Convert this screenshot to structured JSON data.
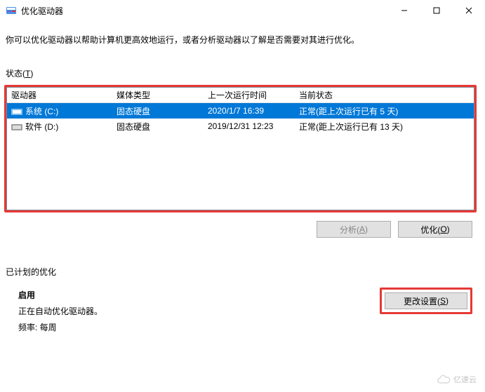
{
  "window": {
    "title": "优化驱动器"
  },
  "description": "你可以优化驱动器以帮助计算机更高效地运行，或者分析驱动器以了解是否需要对其进行优化。",
  "status_label_prefix": "状态(",
  "status_label_key": "T",
  "status_label_suffix": ")",
  "table": {
    "headers": {
      "drive": "驱动器",
      "media": "媒体类型",
      "last_run": "上一次运行时间",
      "current": "当前状态"
    },
    "rows": [
      {
        "drive": "系统 (C:)",
        "media": "固态硬盘",
        "last_run": "2020/1/7 16:39",
        "current": "正常(距上次运行已有 5 天)",
        "selected": true,
        "icon": "drive-blue"
      },
      {
        "drive": "软件 (D:)",
        "media": "固态硬盘",
        "last_run": "2019/12/31 12:23",
        "current": "正常(距上次运行已有 13 天)",
        "selected": false,
        "icon": "drive-gray"
      }
    ]
  },
  "buttons": {
    "analyze_prefix": "分析(",
    "analyze_key": "A",
    "analyze_suffix": ")",
    "optimize_prefix": "优化(",
    "optimize_key": "O",
    "optimize_suffix": ")"
  },
  "scheduled": {
    "section_label": "已计划的优化",
    "enabled_label": "启用",
    "running_text": "正在自动优化驱动器。",
    "freq_text": "频率: 每周",
    "change_prefix": "更改设置(",
    "change_key": "S",
    "change_suffix": ")"
  },
  "watermark": "亿速云"
}
